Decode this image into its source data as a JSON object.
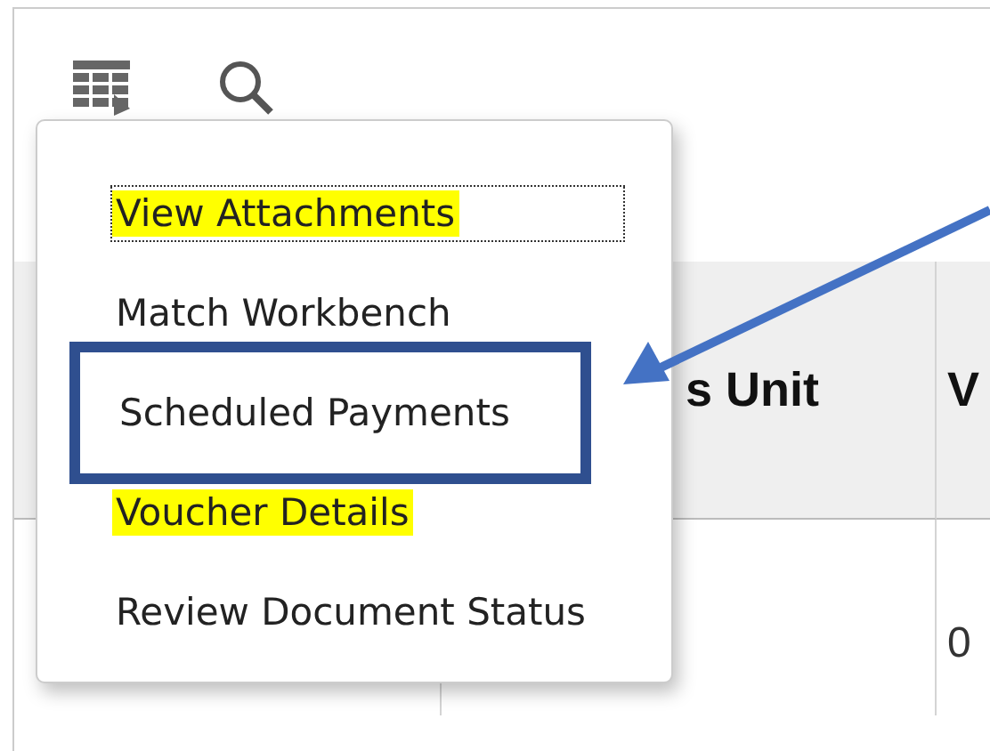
{
  "toolbar": {
    "buttons": [
      {
        "kind": "grid"
      },
      {
        "kind": "search"
      }
    ]
  },
  "table": {
    "columns": [
      "",
      "s Unit",
      "V"
    ],
    "rows": [
      [
        "",
        "",
        "0"
      ]
    ]
  },
  "menu": {
    "items": [
      {
        "label": "View Attachments",
        "highlighted": true,
        "focused": true,
        "boxed": false
      },
      {
        "label": "Match Workbench",
        "highlighted": false,
        "focused": false,
        "boxed": false
      },
      {
        "label": "Scheduled Payments",
        "highlighted": false,
        "focused": false,
        "boxed": true
      },
      {
        "label": "Voucher Details",
        "highlighted": true,
        "focused": false,
        "boxed": false
      },
      {
        "label": "Review Document Status",
        "highlighted": false,
        "focused": false,
        "boxed": false
      }
    ]
  }
}
